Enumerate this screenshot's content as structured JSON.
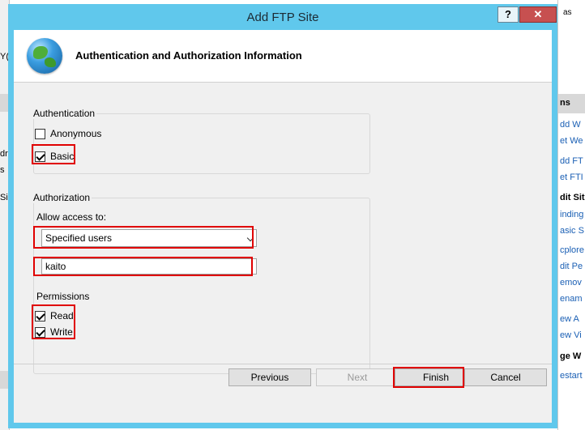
{
  "dialog": {
    "title": "Add FTP Site",
    "help_label": "?",
    "close_label": "✕",
    "banner_title": "Authentication and Authorization Information"
  },
  "authentication": {
    "group_label": "Authentication",
    "anonymous_label": "Anonymous",
    "anonymous_checked": false,
    "basic_label": "Basic",
    "basic_checked": true
  },
  "authorization": {
    "group_label": "Authorization",
    "allow_access_label": "Allow access to:",
    "allow_access_value": "Specified users",
    "users_value": "kaito",
    "permissions_label": "Permissions",
    "read_label": "Read",
    "read_checked": true,
    "write_label": "Write",
    "write_checked": true
  },
  "buttons": {
    "previous": "Previous",
    "next": "Next",
    "finish": "Finish",
    "cancel": "Cancel"
  },
  "background": {
    "left_fragments": [
      "Y(",
      "dr",
      "s",
      "Si"
    ],
    "right_header": "ns",
    "right_top": "as",
    "right_items": [
      {
        "label": "dd W",
        "bold": false
      },
      {
        "label": "et We",
        "bold": false
      },
      {
        "label": "dd FT",
        "bold": false
      },
      {
        "label": "et FTI",
        "bold": false
      },
      {
        "label": "dit Sit",
        "bold": true
      },
      {
        "label": "inding",
        "bold": false
      },
      {
        "label": "asic S",
        "bold": false
      },
      {
        "label": "cplore",
        "bold": false
      },
      {
        "label": "dit Pe",
        "bold": false
      },
      {
        "label": "emov",
        "bold": false
      },
      {
        "label": "enam",
        "bold": false
      },
      {
        "label": "ew A",
        "bold": false
      },
      {
        "label": "ew Vi",
        "bold": false
      },
      {
        "label": "ge W",
        "bold": true
      },
      {
        "label": "estart",
        "bold": false
      }
    ]
  },
  "colors": {
    "title_bar": "#60c8ec",
    "highlight": "#e00000",
    "close_button": "#c75050"
  }
}
